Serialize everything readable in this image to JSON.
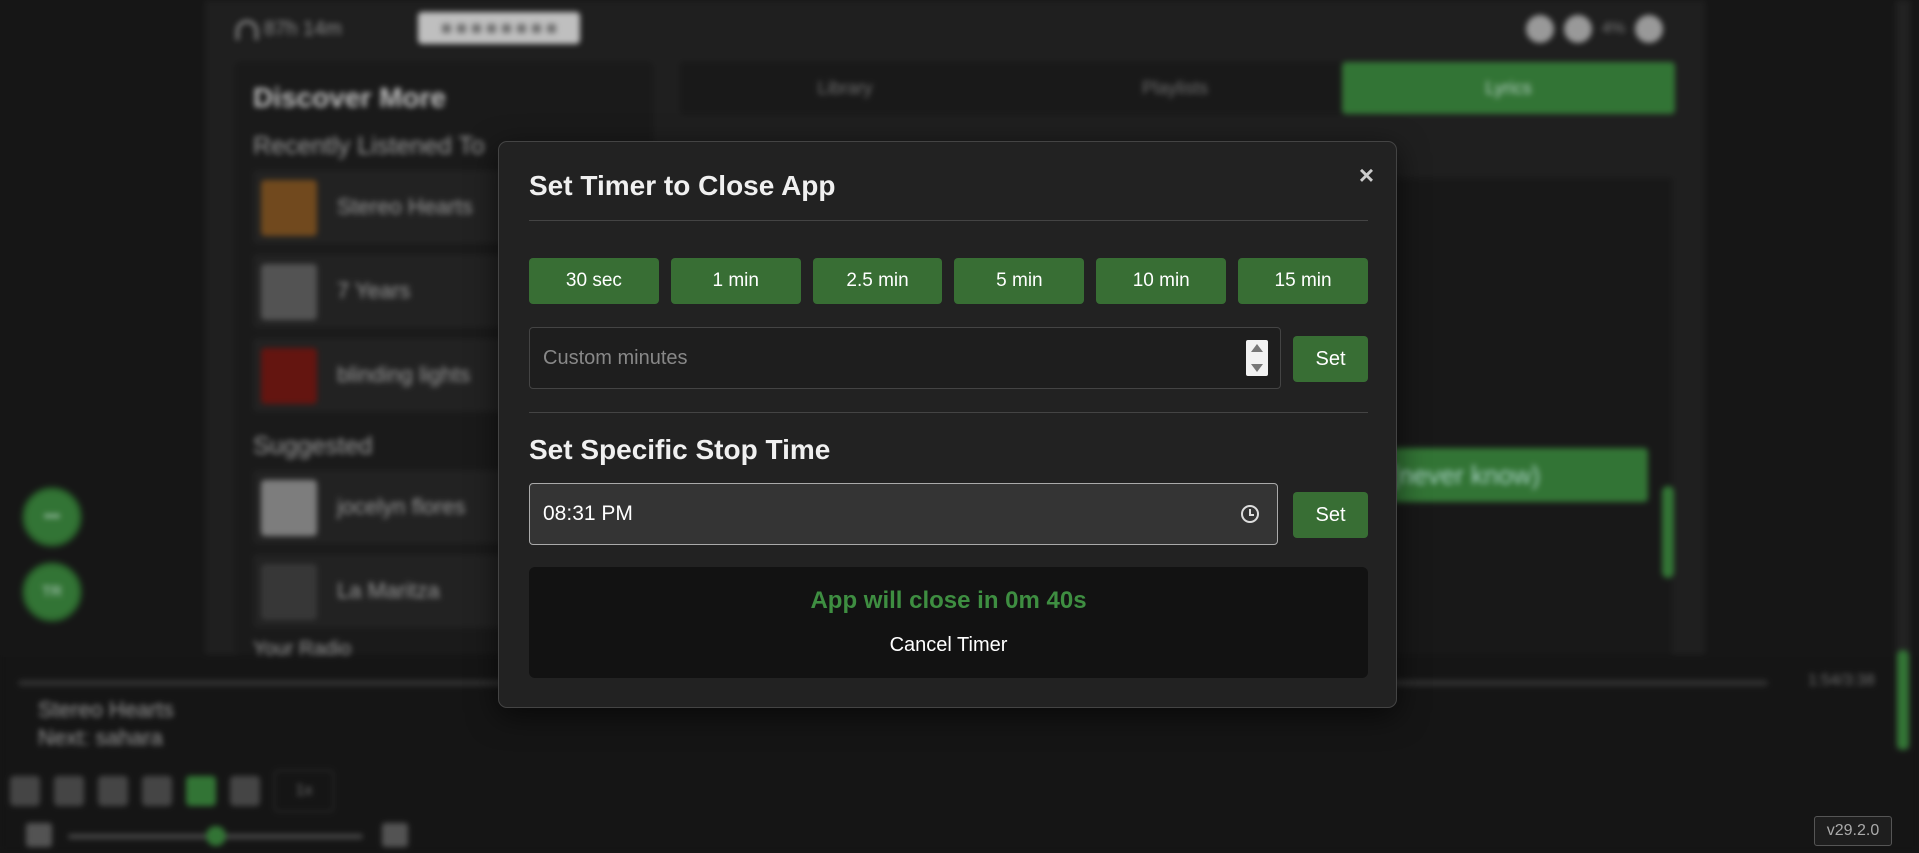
{
  "background": {
    "listen_time": "87h 14m",
    "top_right_text": "4%",
    "discover_title": "Discover More",
    "recent_heading": "Recently Listened To",
    "recent_tracks": [
      "Stereo Hearts",
      "7 Years",
      "blinding lights"
    ],
    "suggested_heading": "Suggested",
    "suggested_tracks": [
      "jocelyn flores",
      "La Maritza"
    ],
    "more_heading": "Your Radio",
    "tabs": [
      "Library",
      "Playlists",
      "Lyrics"
    ],
    "active_tab": "Lyrics",
    "lyric_line": "(never know)",
    "fab_1": "•••",
    "fab_2": "TR",
    "now_playing": "Stereo Hearts",
    "next_up": "Next: sahara",
    "time_display": "1:54/3:38",
    "speed_label": "1x"
  },
  "modal": {
    "title": "Set Timer to Close App",
    "close_symbol": "×",
    "presets": [
      "30 sec",
      "1 min",
      "2.5 min",
      "5 min",
      "10 min",
      "15 min"
    ],
    "custom_placeholder": "Custom minutes",
    "set_label": "Set",
    "section_title": "Set Specific Stop Time",
    "stop_time_value": "08:31 PM",
    "status_text": "App will close in 0m 40s",
    "cancel_label": "Cancel Timer"
  },
  "version": "v29.2.0",
  "colors": {
    "accent": "#3e8e41",
    "button": "#386e34",
    "modal_bg": "#222222"
  }
}
